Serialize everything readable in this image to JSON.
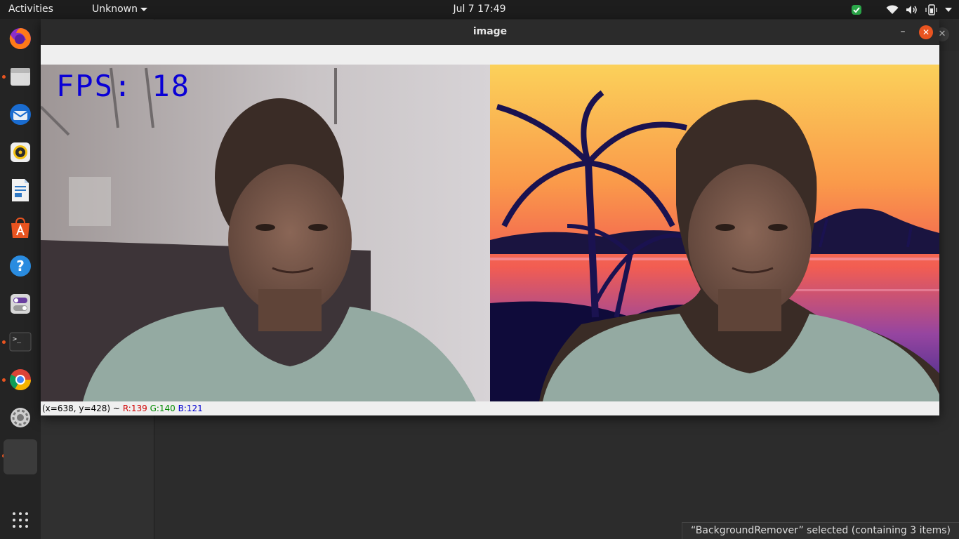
{
  "topbar": {
    "activities": "Activities",
    "app_menu": "Unknown",
    "clock": "Jul 7  17:49",
    "tray_icons": [
      "update-check-icon",
      "wifi-icon",
      "volume-icon",
      "battery-icon",
      "system-menu-caret-icon"
    ]
  },
  "dock": {
    "items": [
      {
        "name": "firefox",
        "running": false
      },
      {
        "name": "files",
        "running": true
      },
      {
        "name": "thunderbird",
        "running": false
      },
      {
        "name": "rhythmbox",
        "running": false
      },
      {
        "name": "libreoffice-writer",
        "running": false
      },
      {
        "name": "ubuntu-software",
        "running": false
      },
      {
        "name": "help",
        "running": false
      },
      {
        "name": "tweaks",
        "running": false
      },
      {
        "name": "terminal",
        "running": true
      },
      {
        "name": "chrome",
        "running": true
      },
      {
        "name": "settings",
        "running": false
      },
      {
        "name": "image-window",
        "running": true
      }
    ],
    "show_apps": "show-applications-icon",
    "accent": "#e95420"
  },
  "image_window": {
    "title": "image",
    "fps_text": "FPS: 18",
    "fps_color": "#0a00d6",
    "status": {
      "coords": "(x=638, y=428) ~",
      "r": "R:139",
      "g": "G:140",
      "b": "B:121"
    }
  },
  "background_files": {
    "toast": "“BackgroundRemover” selected  (containing 3 items)"
  }
}
